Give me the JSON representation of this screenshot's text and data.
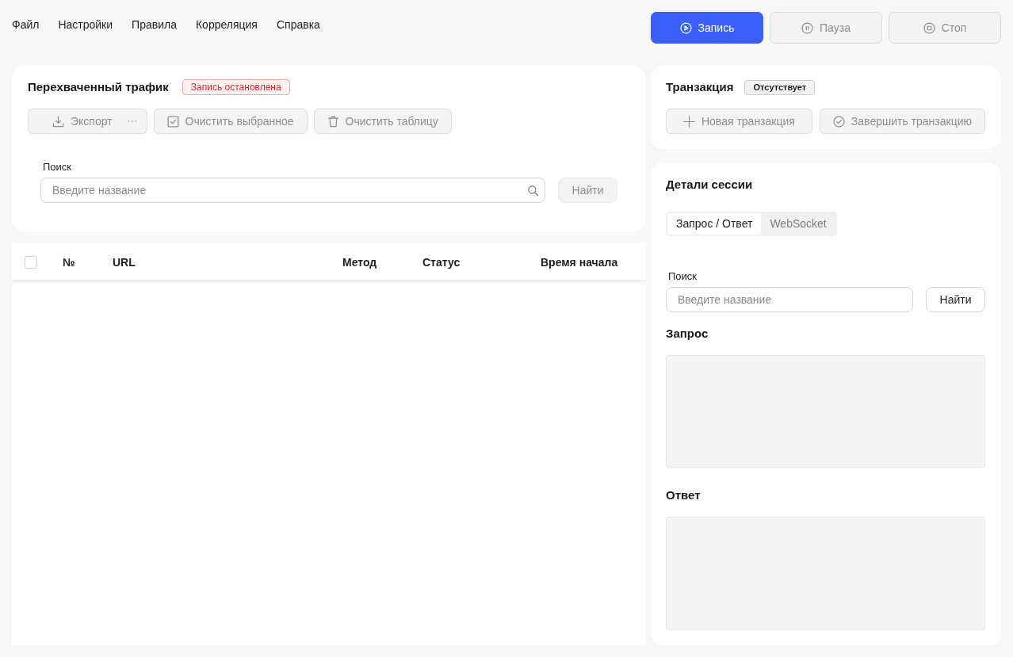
{
  "menu": [
    "Файл",
    "Настройки",
    "Правила",
    "Корреляция",
    "Справка"
  ],
  "recording_controls": [
    {
      "kind": "record",
      "label": "Запись",
      "disabled": false
    },
    {
      "kind": "pause",
      "label": "Пауза",
      "disabled": true
    },
    {
      "kind": "stop",
      "label": "Стоп",
      "disabled": true
    }
  ],
  "traffic_panel": {
    "title": "Перехваченный трафик",
    "status_badge": "Запись остановлена",
    "toolbar": [
      {
        "kind": "export",
        "label": "Экспорт",
        "disabled": true,
        "more_menu": true
      },
      {
        "kind": "clear_selected",
        "label": "Очистить выбранное",
        "disabled": true
      },
      {
        "kind": "clear_table",
        "label": "Очистить таблицу",
        "disabled": true
      }
    ],
    "search": {
      "label": "Поиск",
      "placeholder": "Введите название",
      "button": "Найти",
      "button_disabled": true
    }
  },
  "table": {
    "select_all_checked": false,
    "columns": [
      "№",
      "URL",
      "Метод",
      "Статус",
      "Время начала"
    ]
  },
  "transaction_panel": {
    "title": "Транзакция",
    "status_badge": "Отсутствует",
    "actions": [
      {
        "kind": "new",
        "label": "Новая транзакция",
        "disabled": true
      },
      {
        "kind": "finish",
        "label": "Завершить транзакцию",
        "disabled": true
      }
    ]
  },
  "session_details": {
    "title": "Детали сессии",
    "tabs": [
      {
        "label": "Запрос / Ответ",
        "selected": true
      },
      {
        "label": "WebSocket",
        "selected": false
      }
    ],
    "search": {
      "label": "Поиск",
      "placeholder": "Введите название",
      "button": "Найти",
      "button_disabled": false
    },
    "request": {
      "label": "Запрос"
    },
    "response": {
      "label": "Ответ"
    }
  }
}
